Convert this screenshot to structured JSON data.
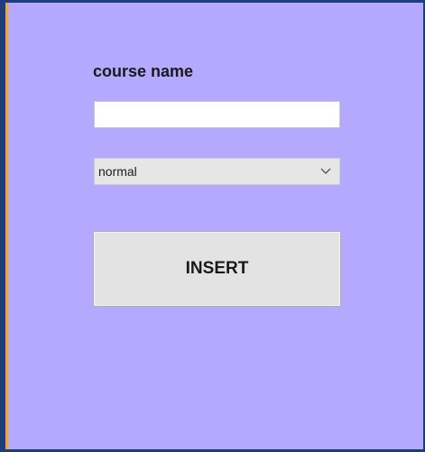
{
  "form": {
    "course_label": "course name",
    "course_value": "",
    "type_select": {
      "selected": "normal",
      "chevron_icon": "chevron-down-icon"
    },
    "insert_label": "INSERT"
  },
  "colors": {
    "frame": "#1f3d78",
    "accent": "#f0a63a",
    "panel": "#b4a8ff",
    "button": "#e3e3e3"
  }
}
